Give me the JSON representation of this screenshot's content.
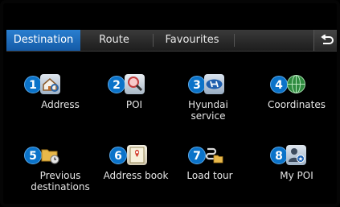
{
  "tabs": [
    {
      "label": "Destination",
      "active": true
    },
    {
      "label": "Route",
      "active": false
    },
    {
      "label": "Favourites",
      "active": false
    }
  ],
  "back_icon": "back-arrow-icon",
  "items": [
    {
      "number": "1",
      "label_lines": [
        "Address"
      ],
      "icon": "house-magnifier-icon"
    },
    {
      "number": "2",
      "label_lines": [
        "POI"
      ],
      "icon": "magnifier-icon"
    },
    {
      "number": "3",
      "label_lines": [
        "Hyundai",
        "service"
      ],
      "icon": "hyundai-logo-icon"
    },
    {
      "number": "4",
      "label_lines": [
        "Coordinates"
      ],
      "icon": "globe-icon"
    },
    {
      "number": "5",
      "label_lines": [
        "Previous",
        "destinations"
      ],
      "icon": "folder-clock-icon"
    },
    {
      "number": "6",
      "label_lines": [
        "Address book"
      ],
      "icon": "address-book-icon"
    },
    {
      "number": "7",
      "label_lines": [
        "Load tour"
      ],
      "icon": "load-tour-icon"
    },
    {
      "number": "8",
      "label_lines": [
        "My POI"
      ],
      "icon": "my-poi-icon"
    }
  ],
  "colors": {
    "active_tab": "#1e6cc0",
    "number_badge": "#0b73c9"
  }
}
